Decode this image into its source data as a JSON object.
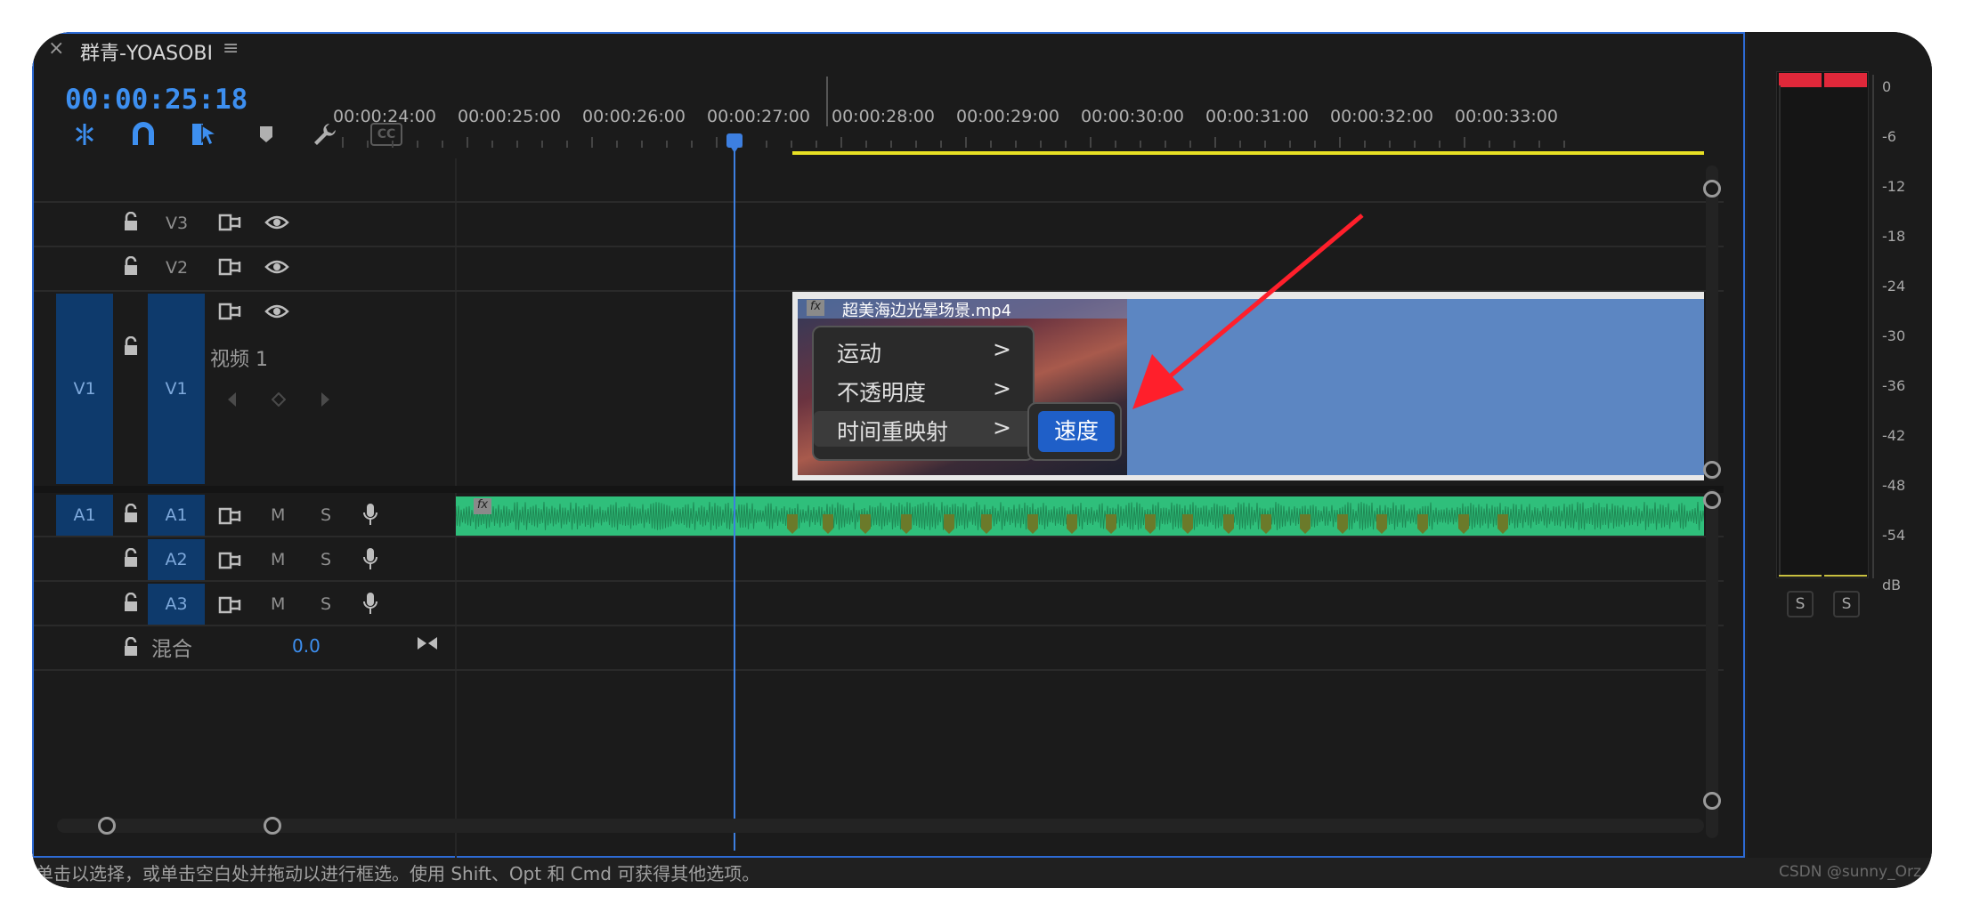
{
  "window": {
    "close_glyph": "×",
    "sequence_title": "群青-YOASOBI",
    "menu_glyph": "≡"
  },
  "timecode": "00:00:25:18",
  "toolbar_icons": [
    "ripple-insert-icon",
    "snap-magnet-icon",
    "linked-selection-icon",
    "add-marker-icon",
    "wrench-settings-icon",
    "captions-icon"
  ],
  "toolbar_cc_label": "CC",
  "ruler": {
    "labels": [
      "00:00:24:00",
      "00:00:25:00",
      "00:00:26:00",
      "00:00:27:00",
      "00:00:28:00",
      "00:00:29:00",
      "00:00:30:00",
      "00:00:31:00",
      "00:00:32:00",
      "00:00:33:00"
    ]
  },
  "tracks": {
    "v3": "V3",
    "v2": "V2",
    "v1_source": "V1",
    "v1": "V1",
    "v1_name": "视频 1",
    "a1_source": "A1",
    "a1": "A1",
    "a2": "A2",
    "a3": "A3",
    "mute_label": "M",
    "solo_label": "S",
    "mix_label": "混合",
    "mix_value": "0.0"
  },
  "clip": {
    "fx_label": "fx",
    "name": "超美海边光晕场景.mp4",
    "audio_fx_label": "fx"
  },
  "context_menu": {
    "items": [
      "运动",
      "不透明度",
      "时间重映射"
    ],
    "arrow": ">",
    "submenu_item": "速度"
  },
  "meter": {
    "scale": [
      "0",
      "-6",
      "-12",
      "-18",
      "-24",
      "-30",
      "-36",
      "-42",
      "-48",
      "-54",
      "dB"
    ],
    "solo_left": "S",
    "solo_right": "S"
  },
  "status_text": "单击以选择，或单击空白处并拖动以进行框选。使用 Shift、Opt 和 Cmd 可获得其他选项。",
  "watermark": "CSDN @sunny_Orz",
  "colors": {
    "accent_blue": "#2d6bd6",
    "timecode_blue": "#3d8ff0",
    "video_clip": "#5c86c2",
    "audio_clip": "#2fbf7b",
    "menu_highlight": "#1f5fc8",
    "annotation_red": "#ff1f2b",
    "work_area_yellow": "#e8e024"
  }
}
